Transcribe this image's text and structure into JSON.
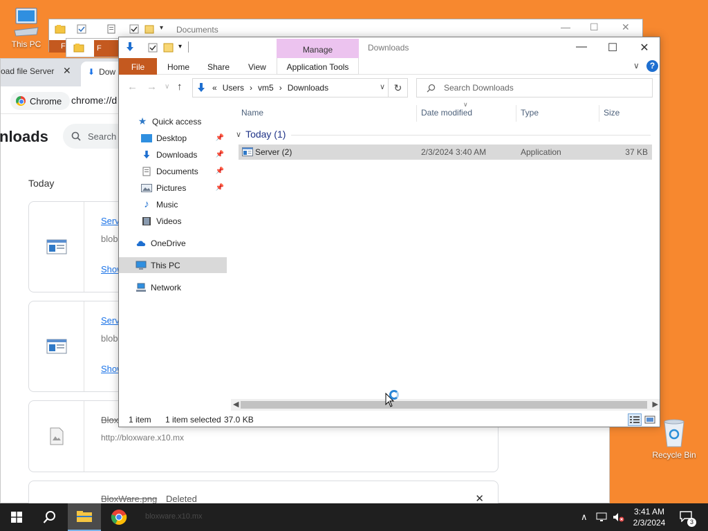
{
  "desktop": {
    "this_pc_label": "This PC",
    "recycle_bin_label": "Recycle Bin"
  },
  "chrome": {
    "tab_title_partial": "oad file Server",
    "tab_close": "✕",
    "active_tab_partial": "Dow",
    "chip_label": "Chrome",
    "url_partial": "chrome://d",
    "heading_partial": "nloads",
    "search_partial": "Search",
    "group_today": "Today",
    "cards": [
      {
        "name_partial": "Serv",
        "subtext_partial": "blob",
        "action_partial": "Show"
      },
      {
        "name_partial": "Serv",
        "subtext_partial": "blob",
        "action_partial": "Show"
      },
      {
        "name_partial": "Blox",
        "url": "http://bloxware.x10.mx"
      },
      {
        "name": "BloxWare.png",
        "status": "Deleted",
        "remove": "✕"
      }
    ]
  },
  "back_explorer": {
    "title": "Documents",
    "file_tab_partial": "F"
  },
  "explorer": {
    "manage_tab": "Manage",
    "window_title": "Downloads",
    "ribbon": {
      "file": "File",
      "home": "Home",
      "share": "Share",
      "view": "View",
      "application_tools": "Application Tools"
    },
    "address": {
      "overflow": "«",
      "crumbs": [
        "Users",
        "vm5",
        "Downloads"
      ]
    },
    "search_placeholder": "Search Downloads",
    "nav": {
      "quick_access": "Quick access",
      "desktop": "Desktop",
      "downloads": "Downloads",
      "documents": "Documents",
      "pictures": "Pictures",
      "music": "Music",
      "videos": "Videos",
      "onedrive": "OneDrive",
      "this_pc": "This PC",
      "network": "Network"
    },
    "columns": {
      "name": "Name",
      "date_modified": "Date modified",
      "type": "Type",
      "size": "Size"
    },
    "group": "Today (1)",
    "files": [
      {
        "name": "Server (2)",
        "date": "2/3/2024 3:40 AM",
        "type": "Application",
        "size": "37 KB"
      }
    ],
    "status": {
      "count": "1 item",
      "selected": "1 item selected",
      "selected_size": "37.0 KB"
    }
  },
  "taskbar": {
    "ghost_text": "bloxware.x10.mx",
    "time": "3:41 AM",
    "date": "2/3/2024",
    "notification_count": "3"
  },
  "colors": {
    "desktop_bg": "#f7882f",
    "file_tab": "#c4591f",
    "manage_tab": "#ecc3ef",
    "accent_blue": "#1e6fd0"
  }
}
